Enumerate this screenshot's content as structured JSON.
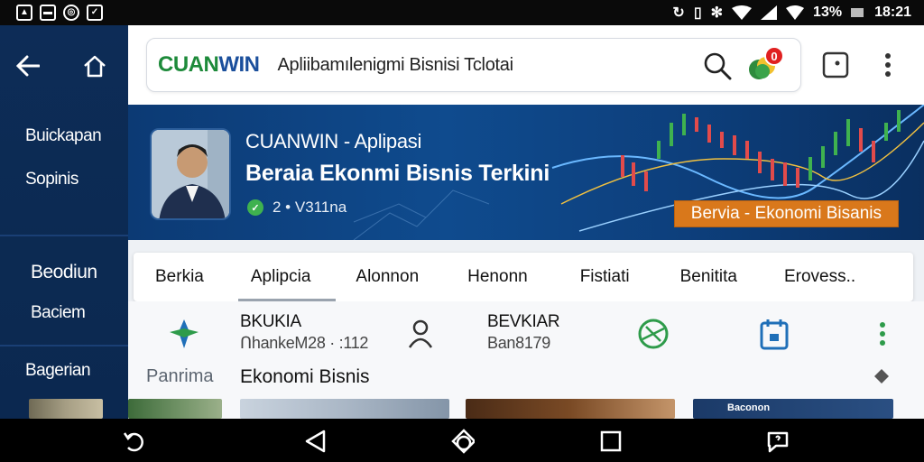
{
  "status_bar": {
    "battery": "13%",
    "time": "18:21"
  },
  "rail": {
    "items": [
      {
        "label": "Buickapan"
      },
      {
        "label": "Sopinis"
      },
      {
        "label": "Beodiun"
      },
      {
        "label": "Baciem"
      },
      {
        "label": "Bagerian"
      }
    ]
  },
  "search_bar": {
    "brand_part1": "CUAN",
    "brand_part2": "WIN",
    "tagline": "Apliibamılenigmi Bisnisi Tclotai",
    "notification_count": "0"
  },
  "hero": {
    "subtitle": "CUANWIN - Aplipasi",
    "title": "Beraia Ekonmi Bisnis Terkini",
    "meta": "2 • V311na",
    "tag": "Bervia - Ekonomi Bisanis"
  },
  "tabs": [
    {
      "label": "Berkia"
    },
    {
      "label": "Aplipcia"
    },
    {
      "label": "Alonnon"
    },
    {
      "label": "Henonn"
    },
    {
      "label": "Fistiati"
    },
    {
      "label": "Benitita"
    },
    {
      "label": "Erovess.."
    }
  ],
  "rows": [
    {
      "title": "BKUKIA",
      "subtitle": "ՈhankeM28 · :112"
    },
    {
      "title": "BEVKIAR",
      "subtitle": "Ban8179"
    }
  ],
  "section": {
    "label": "Panrima",
    "title": "Ekonomi Bisnis"
  },
  "cards": [
    {
      "label": ""
    },
    {
      "label": ""
    },
    {
      "label": ""
    },
    {
      "label": "Baconon"
    }
  ],
  "colors": {
    "rail": "#0d2c57",
    "brand_green": "#1d8a3a",
    "brand_blue": "#1b4f9c",
    "hero_tag": "#d9781b",
    "badge": "#e02020"
  }
}
